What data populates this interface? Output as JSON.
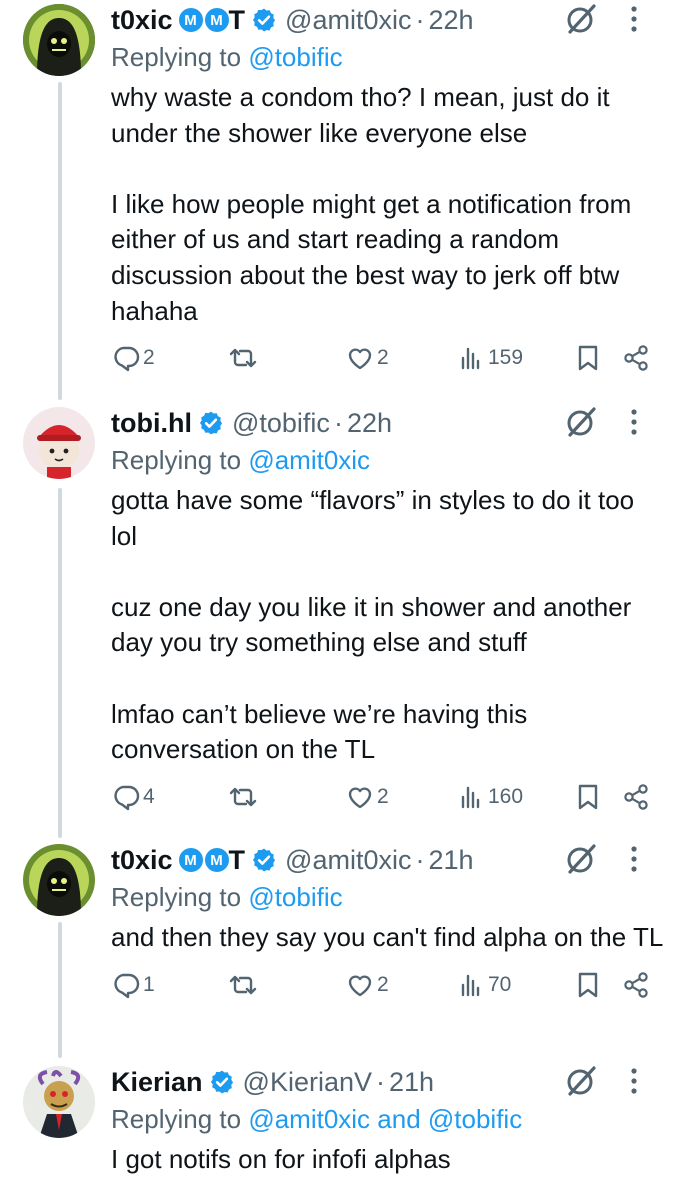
{
  "tweets": [
    {
      "name": "t0xic",
      "badges": [
        "M",
        "M"
      ],
      "name_suffix": "T",
      "handle": "@amit0xic",
      "time": "22h",
      "replying_label": "Replying to",
      "replying_to": "@tobific",
      "text": "why waste a condom tho? I mean, just do it under the shower like everyone else\n\nI like how people might get a notification from either of us and start reading a random discussion about the best way to jerk off btw hahaha",
      "replies": "2",
      "reposts": "",
      "likes": "2",
      "views": "159"
    },
    {
      "name": "tobi.hl",
      "badges": [],
      "name_suffix": "",
      "handle": "@tobific",
      "time": "22h",
      "replying_label": "Replying to",
      "replying_to": "@amit0xic",
      "text": "gotta have some “flavors” in styles to do it too lol\n\ncuz one day you like it in shower and another day you try something else and stuff\n\nlmfao can’t believe we’re having this conversation on the TL",
      "replies": "4",
      "reposts": "",
      "likes": "2",
      "views": "160"
    },
    {
      "name": "t0xic",
      "badges": [
        "M",
        "M"
      ],
      "name_suffix": "T",
      "handle": "@amit0xic",
      "time": "21h",
      "replying_label": "Replying to",
      "replying_to": "@tobific",
      "text": "and then they say you can't find alpha on the TL",
      "replies": "1",
      "reposts": "",
      "likes": "2",
      "views": "70"
    },
    {
      "name": "Kierian",
      "badges": [],
      "name_suffix": "",
      "handle": "@KierianV",
      "time": "21h",
      "replying_label": "Replying to",
      "replying_to": "@amit0xic and @tobific",
      "text": "I got notifs on for infofi alphas"
    }
  ],
  "colors": {
    "accent": "#1d9bf0",
    "muted": "#536471",
    "text": "#0f1419",
    "thread": "#cfd9de"
  },
  "icons": [
    "grok-icon",
    "more-icon",
    "reply-icon",
    "repost-icon",
    "like-icon",
    "views-icon",
    "bookmark-icon",
    "share-icon",
    "verified-icon"
  ]
}
